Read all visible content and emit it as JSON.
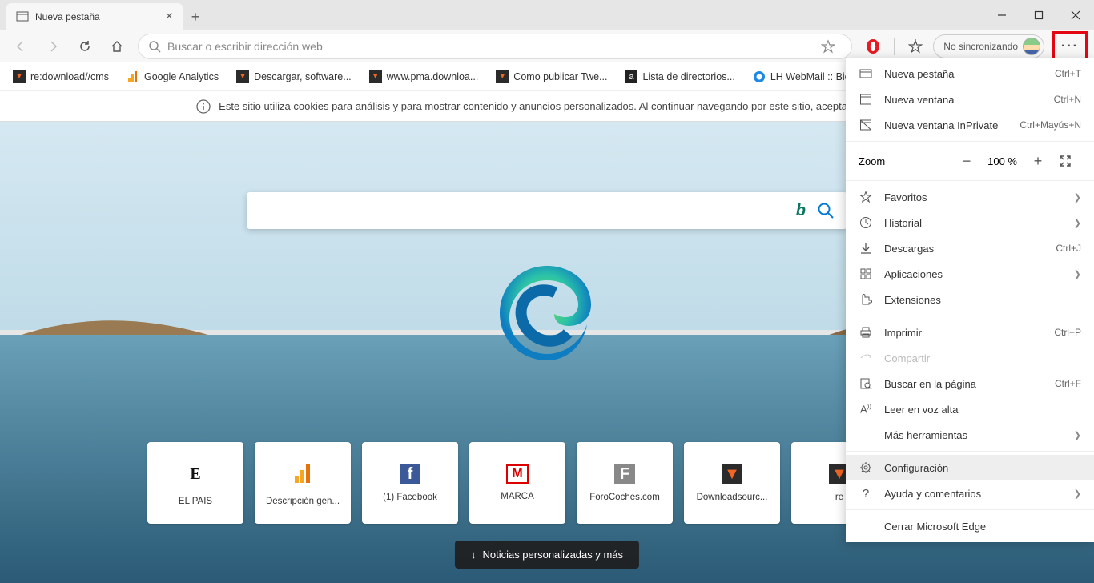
{
  "tab": {
    "title": "Nueva pestaña"
  },
  "addressbar": {
    "placeholder": "Buscar o escribir dirección web"
  },
  "sync": {
    "label": "No sincronizando"
  },
  "bookmarks": [
    {
      "label": "re:download//cms",
      "color": "#2b2b2b",
      "accent": "#f26522"
    },
    {
      "label": "Google Analytics",
      "color": "transparent",
      "accent": "#f5a623"
    },
    {
      "label": "Descargar, software...",
      "color": "#2b2b2b",
      "accent": "#f26522"
    },
    {
      "label": "www.pma.downloa...",
      "color": "#2b2b2b",
      "accent": "#f26522"
    },
    {
      "label": "Como publicar Twe...",
      "color": "#2b2b2b",
      "accent": "#f26522"
    },
    {
      "label": "Lista de directorios...",
      "color": "#222",
      "accent": "#fff"
    },
    {
      "label": "LH WebMail :: Bienv...",
      "color": "transparent",
      "accent": "#1e88e5"
    }
  ],
  "cookie": {
    "text": "Este sitio utiliza cookies para análisis y para mostrar contenido y anuncios personalizados. Al continuar navegando por este sitio, aceptas este uso."
  },
  "tiles": [
    {
      "label": "EL PAÍS",
      "icon": "E",
      "bg": "#fff",
      "fg": "#111"
    },
    {
      "label": "Descripción gen...",
      "icon": "ga",
      "bg": "#fff",
      "fg": "#f5a623"
    },
    {
      "label": "(1) Facebook",
      "icon": "f",
      "bg": "#3b5998",
      "fg": "#fff"
    },
    {
      "label": "MARCA",
      "icon": "M",
      "bg": "#fff",
      "fg": "#d00"
    },
    {
      "label": "ForoCoches.com",
      "icon": "F",
      "bg": "#888",
      "fg": "#fff"
    },
    {
      "label": "Downloadsourc...",
      "icon": "▼",
      "bg": "#2b2b2b",
      "fg": "#f26522"
    },
    {
      "label": "re",
      "icon": "▼",
      "bg": "#2b2b2b",
      "fg": "#f26522"
    }
  ],
  "news": {
    "label": "Noticias personalizadas y más"
  },
  "menu": {
    "new_tab": {
      "label": "Nueva pestaña",
      "shortcut": "Ctrl+T"
    },
    "new_window": {
      "label": "Nueva ventana",
      "shortcut": "Ctrl+N"
    },
    "new_inprivate": {
      "label": "Nueva ventana InPrivate",
      "shortcut": "Ctrl+Mayús+N"
    },
    "zoom": {
      "label": "Zoom",
      "value": "100 %"
    },
    "favorites": {
      "label": "Favoritos"
    },
    "history": {
      "label": "Historial"
    },
    "downloads": {
      "label": "Descargas",
      "shortcut": "Ctrl+J"
    },
    "apps": {
      "label": "Aplicaciones"
    },
    "extensions": {
      "label": "Extensiones"
    },
    "print": {
      "label": "Imprimir",
      "shortcut": "Ctrl+P"
    },
    "share": {
      "label": "Compartir"
    },
    "find": {
      "label": "Buscar en la página",
      "shortcut": "Ctrl+F"
    },
    "read": {
      "label": "Leer en voz alta"
    },
    "more_tools": {
      "label": "Más herramientas"
    },
    "settings": {
      "label": "Configuración"
    },
    "help": {
      "label": "Ayuda y comentarios"
    },
    "close": {
      "label": "Cerrar Microsoft Edge"
    }
  }
}
